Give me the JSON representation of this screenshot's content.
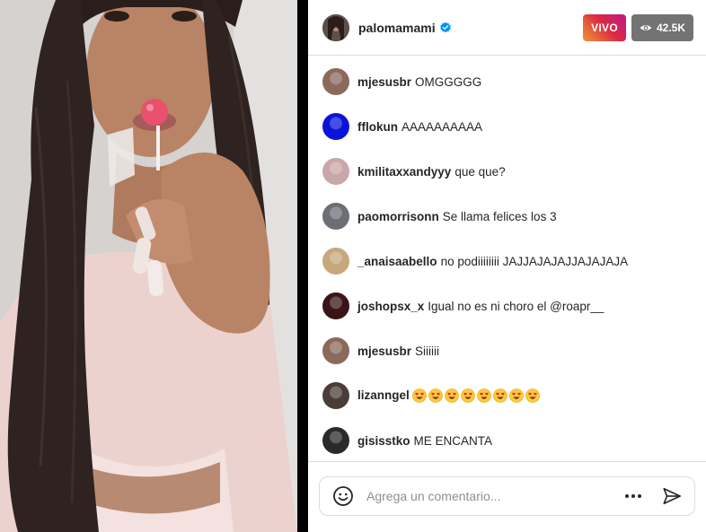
{
  "stream": {
    "username": "palomamami",
    "verified": true,
    "live_label": "VIVO",
    "viewers": "42.5K"
  },
  "comments": [
    {
      "user": "mjesusbr",
      "text": "OMGGGGG",
      "avatar_color": "#8a6a5a"
    },
    {
      "user": "fflokun",
      "text": "AAAAAAAAAA",
      "avatar_color": "#0a14d8"
    },
    {
      "user": "kmilitaxxandyyy",
      "text": "que que?",
      "avatar_color": "#c9a6a8"
    },
    {
      "user": "paomorrisonn",
      "text": "Se llama felices los 3",
      "avatar_color": "#6b6f75"
    },
    {
      "user": "_anaisaabello",
      "text": "no podiiiiiiii JAJJAJAJAJJAJAJAJA",
      "avatar_color": "#c7a77c"
    },
    {
      "user": "joshopsx_x",
      "text": "Igual no es ni choro el @roapr__",
      "avatar_color": "#3a1416"
    },
    {
      "user": "mjesusbr",
      "text": "Siiiiii",
      "avatar_color": "#8a6a5a"
    },
    {
      "user": "lizanngel",
      "text": "",
      "emoji_count": 8,
      "avatar_color": "#4a3c38"
    },
    {
      "user": "gisisstko",
      "text": "ME ENCANTA",
      "avatar_color": "#2a2a2a"
    }
  ],
  "composer": {
    "placeholder": "Agrega un comentario..."
  },
  "colors": {
    "live_gradient_start": "#f09433",
    "live_gradient_end": "#bc1888",
    "viewer_badge": "#737373",
    "verified": "#0095f6"
  }
}
